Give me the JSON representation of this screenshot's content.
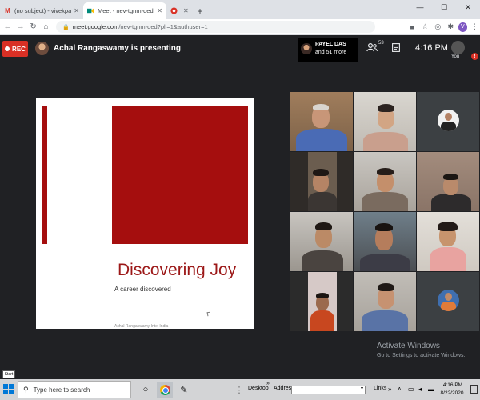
{
  "browser": {
    "tabs": [
      {
        "title": "(no subject) - vivekpachauri@ita",
        "icon": "gmail-icon",
        "active": false
      },
      {
        "title": "Meet - nev-tgnm-qed",
        "icon": "meet-icon",
        "active": true
      },
      {
        "title": "",
        "icon": "record-icon",
        "active": false
      }
    ],
    "url_host": "meet.google.com",
    "url_rest": "/nev-tgnm-qed?pli=1&authuser=1",
    "profile_initial": "V"
  },
  "meet": {
    "rec_label": "REC",
    "presenting_text": "Achal Rangaswamy is presenting",
    "people_card": {
      "name": "PAYEL DAS",
      "more": "and 51 more"
    },
    "people_count": "53",
    "time": "4:16 PM",
    "you_label": "You",
    "alert_badge": "!",
    "colors": {
      "rec": "#d93025",
      "background": "#202124",
      "slide_accent": "#a50e0e"
    }
  },
  "slide": {
    "title": "Discovering Joy",
    "subtitle": "A career discovered",
    "footer": "Achal Rangaswamy   Intel India"
  },
  "watermark": {
    "line1": "Activate Windows",
    "line2": "Go to Settings to activate Windows."
  },
  "taskbar": {
    "start_tooltip": "Start",
    "search_placeholder": "Type here to search",
    "desktop_label": "Desktop",
    "address_label": "Address",
    "links_label": "Links",
    "time": "4:16 PM",
    "date": "8/22/2020"
  }
}
